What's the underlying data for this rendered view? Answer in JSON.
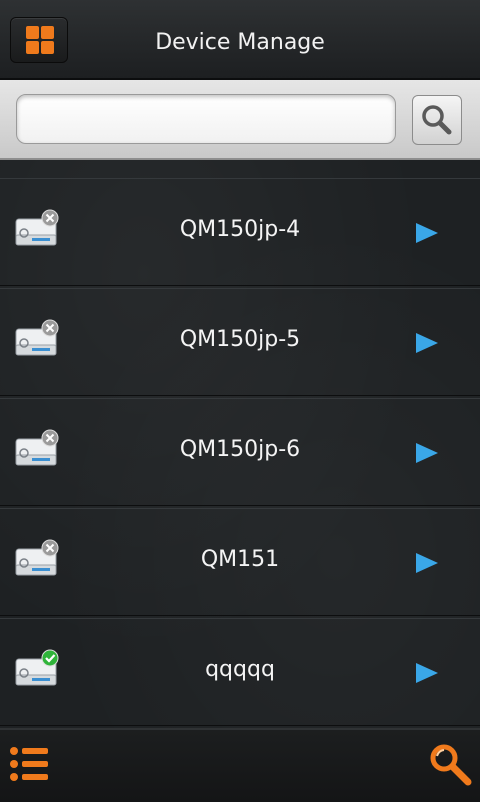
{
  "header": {
    "title": "Device Manage",
    "menu_icon": "grid-icon",
    "accent": "#f07a1c"
  },
  "search": {
    "value": "",
    "placeholder": "",
    "button_icon": "magnifier-icon"
  },
  "devices": [
    {
      "name": "QM150jp-4",
      "status": "offline"
    },
    {
      "name": "QM150jp-5",
      "status": "offline"
    },
    {
      "name": "QM150jp-6",
      "status": "offline"
    },
    {
      "name": "QM151",
      "status": "offline"
    },
    {
      "name": "qqqqq",
      "status": "online"
    }
  ],
  "footer": {
    "left_icon": "list-menu-icon",
    "right_icon": "search-device-icon"
  },
  "colors": {
    "arrow": "#3aa7e8",
    "online": "#2fb43a",
    "offline": "#9a9a9a"
  }
}
